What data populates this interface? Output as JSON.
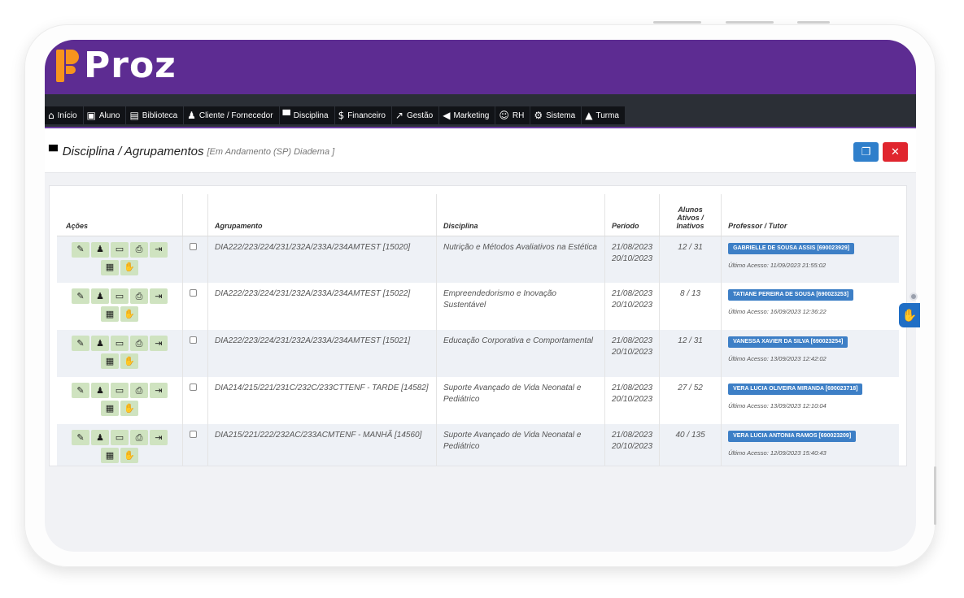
{
  "brand": {
    "name": "Proz",
    "colors": {
      "header": "#5d2c92",
      "accent": "#f7941d",
      "nav": "#2b2f36"
    }
  },
  "nav": [
    {
      "label": "Início",
      "icon": "home-icon",
      "glyph": "⌂"
    },
    {
      "label": "Aluno",
      "icon": "id-card-icon",
      "glyph": "▣"
    },
    {
      "label": "Biblioteca",
      "icon": "book-icon",
      "glyph": "▤"
    },
    {
      "label": "Cliente / Fornecedor",
      "icon": "user-plus-icon",
      "glyph": "♟"
    },
    {
      "label": "Disciplina",
      "icon": "chalkboard-icon",
      "glyph": "▀"
    },
    {
      "label": "Financeiro",
      "icon": "dollar-icon",
      "glyph": "$"
    },
    {
      "label": "Gestão",
      "icon": "trend-icon",
      "glyph": "↗"
    },
    {
      "label": "Marketing",
      "icon": "megaphone-icon",
      "glyph": "◀"
    },
    {
      "label": "RH",
      "icon": "smile-icon",
      "glyph": "☺"
    },
    {
      "label": "Sistema",
      "icon": "gear-icon",
      "glyph": "⚙"
    },
    {
      "label": "Turma",
      "icon": "graduation-cap-icon",
      "glyph": "▲"
    }
  ],
  "page": {
    "title": "Disciplina / Agrupamentos",
    "subtitle": "[Em Andamento (SP) Diadema ]",
    "title_icon": "chalkboard-icon"
  },
  "toolbar": {
    "copy_icon": "clipboard-icon",
    "close_icon": "close-icon"
  },
  "table": {
    "headers": {
      "actions": "Ações",
      "select": "",
      "group": "Agrupamento",
      "subject": "Disciplina",
      "period": "Período",
      "students": "Alunos Ativos / Inativos",
      "teacher": "Professor / Tutor"
    },
    "action_icons": [
      "edit-icon",
      "users-icon",
      "monitor-icon",
      "print-icon",
      "export-icon",
      "calendar-icon",
      "hand-icon"
    ],
    "rows": [
      {
        "group": "DIA222/223/224/231/232A/233A/234AMTEST [15020]",
        "subject": "Nutrição e Métodos Avaliativos na Estética",
        "start": "21/08/2023",
        "end": "20/10/2023",
        "students": "12 / 31",
        "teacher": "GABRIELLE DE SOUSA ASSIS [690023929]",
        "access": "Último Acesso: 11/09/2023 21:55:02"
      },
      {
        "group": "DIA222/223/224/231/232A/233A/234AMTEST [15022]",
        "subject": "Empreendedorismo e Inovação Sustentável",
        "start": "21/08/2023",
        "end": "20/10/2023",
        "students": "8 / 13",
        "teacher": "TATIANE PEREIRA DE SOUSA [690023253]",
        "access": "Último Acesso: 16/09/2023 12:36:22"
      },
      {
        "group": "DIA222/223/224/231/232A/233A/234AMTEST [15021]",
        "subject": "Educação Corporativa e Comportamental",
        "start": "21/08/2023",
        "end": "20/10/2023",
        "students": "12 / 31",
        "teacher": "VANESSA XAVIER DA SILVA [690023254]",
        "access": "Último Acesso: 13/09/2023 12:42:02"
      },
      {
        "group": "DIA214/215/221/231C/232C/233CTTENF - TARDE [14582]",
        "subject": "Suporte Avançado de Vida Neonatal e Pediátrico",
        "start": "21/08/2023",
        "end": "20/10/2023",
        "students": "27 / 52",
        "teacher": "VERA LUCIA OLIVEIRA MIRANDA [690023718]",
        "access": "Último Acesso: 13/09/2023 12:10:04"
      },
      {
        "group": "DIA215/221/222/232AC/233ACMTENF - MANHÃ [14560]",
        "subject": "Suporte Avançado de Vida Neonatal e Pediátrico",
        "start": "21/08/2023",
        "end": "20/10/2023",
        "students": "40 / 135",
        "teacher": "VERA LUCIA ANTONIA RAMOS [690023209]",
        "access": "Último Acesso: 12/09/2023 15:40:43"
      }
    ]
  },
  "accessibility": {
    "libras_icon": "sign-language-icon"
  }
}
